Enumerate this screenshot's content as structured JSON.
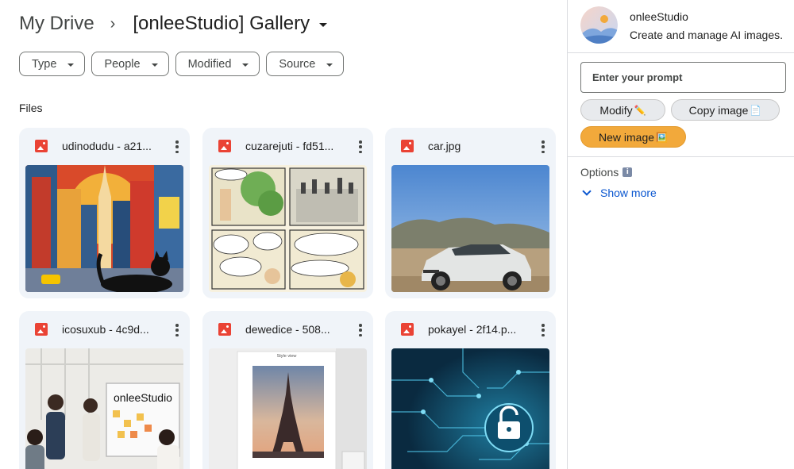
{
  "breadcrumb": {
    "root": "My Drive",
    "separator": "›",
    "current": "[onleeStudio] Gallery"
  },
  "filters": [
    "Type",
    "People",
    "Modified",
    "Source"
  ],
  "section_label": "Files",
  "files": [
    {
      "name": "udinodudu - a21...",
      "thumb": "city-cat"
    },
    {
      "name": "cuzarejuti - fd51...",
      "thumb": "comic"
    },
    {
      "name": "car.jpg",
      "thumb": "car"
    },
    {
      "name": "icosuxub - 4c9d...",
      "thumb": "office"
    },
    {
      "name": "dewedice - 508...",
      "thumb": "eiffel"
    },
    {
      "name": "pokayel - 2f14.p...",
      "thumb": "circuit"
    }
  ],
  "thumb_text": {
    "office_sign": "onleeStudio",
    "eiffel_caption": "Style view"
  },
  "panel": {
    "app_name": "onleeStudio",
    "app_desc": "Create and manage AI images.",
    "prompt_placeholder": "Enter your prompt",
    "modify_label": "Modify",
    "modify_glyph": "✏️",
    "copy_label": "Copy image",
    "copy_glyph": "📄",
    "new_label": "New image",
    "new_glyph": "🖼️",
    "options_label": "Options",
    "options_icon": "i",
    "show_more": "Show more"
  },
  "colors": {
    "accent": "#0b57d0",
    "new_button": "#f2a93b",
    "card_bg": "#f0f4f9",
    "file_icon": "#ea4335"
  }
}
